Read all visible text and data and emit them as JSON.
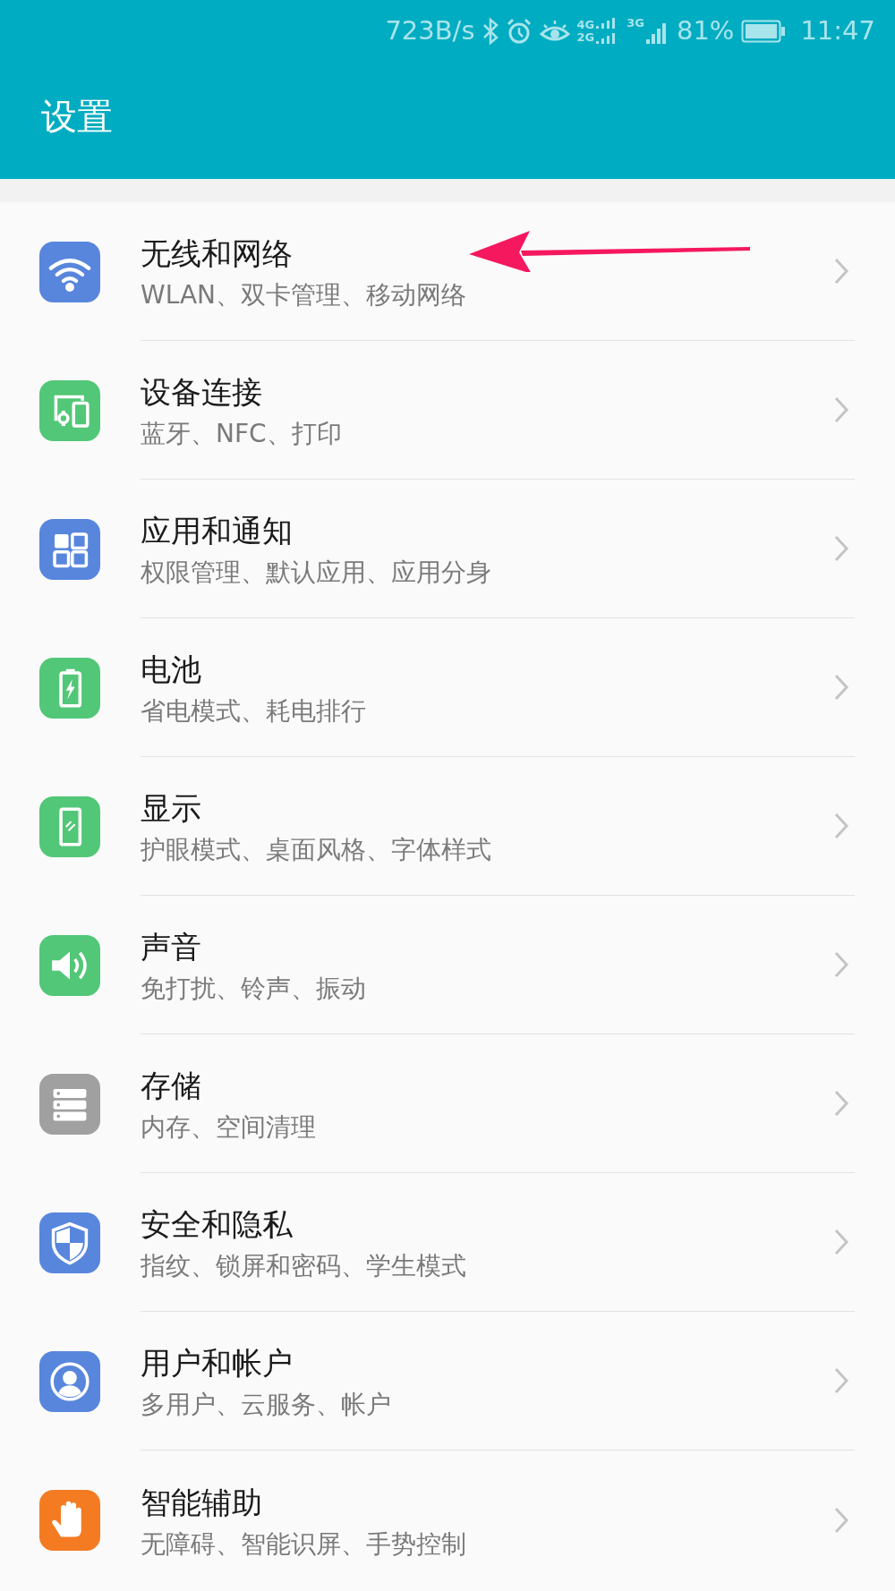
{
  "status_bar": {
    "speed": "723B/s",
    "sim1_top": "4G",
    "sim1_bottom": "2G",
    "sim2": "3G",
    "battery": "81%",
    "time": "11:47"
  },
  "header": {
    "title": "设置"
  },
  "items": [
    {
      "title": "无线和网络",
      "subtitle": "WLAN、双卡管理、移动网络",
      "color": "#5886dc"
    },
    {
      "title": "设备连接",
      "subtitle": "蓝牙、NFC、打印",
      "color": "#52c777"
    },
    {
      "title": "应用和通知",
      "subtitle": "权限管理、默认应用、应用分身",
      "color": "#5886dc"
    },
    {
      "title": "电池",
      "subtitle": "省电模式、耗电排行",
      "color": "#52c777"
    },
    {
      "title": "显示",
      "subtitle": "护眼模式、桌面风格、字体样式",
      "color": "#52c777"
    },
    {
      "title": "声音",
      "subtitle": "免打扰、铃声、振动",
      "color": "#52c777"
    },
    {
      "title": "存储",
      "subtitle": "内存、空间清理",
      "color": "#a0a0a0"
    },
    {
      "title": "安全和隐私",
      "subtitle": "指纹、锁屏和密码、学生模式",
      "color": "#5886dc"
    },
    {
      "title": "用户和帐户",
      "subtitle": "多用户、云服务、帐户",
      "color": "#5886dc"
    },
    {
      "title": "智能辅助",
      "subtitle": "无障碍、智能识屏、手势控制",
      "color": "#f47b22"
    }
  ]
}
